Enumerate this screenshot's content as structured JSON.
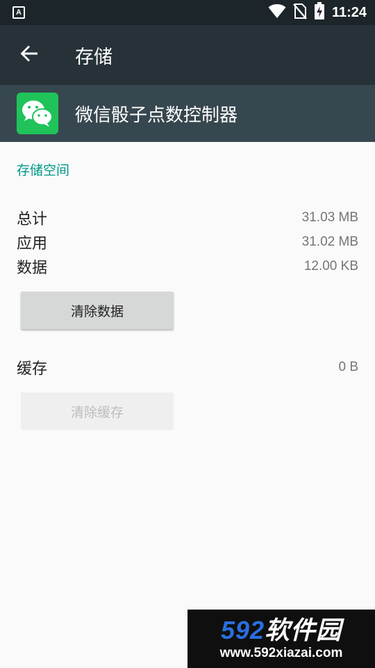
{
  "status_bar": {
    "notification_letter": "A",
    "time": "11:24",
    "icons": [
      "wifi-icon",
      "no-sim-icon",
      "battery-charging-icon"
    ]
  },
  "app_bar": {
    "title": "存储",
    "back_icon": "arrow-back-icon"
  },
  "app_header": {
    "app_name": "微信骰子点数控制器",
    "app_icon": "wechat-icon",
    "app_icon_color": "#1fc35a"
  },
  "storage": {
    "section_title": "存储空间",
    "total_label": "总计",
    "total_value": "31.03 MB",
    "app_label": "应用",
    "app_value": "31.02 MB",
    "data_label": "数据",
    "data_value": "12.00 KB",
    "clear_data_label": "清除数据",
    "cache_label": "缓存",
    "cache_value": "0 B",
    "clear_cache_label": "清除缓存"
  },
  "watermark": {
    "logo_number": "592",
    "logo_text": "软件园",
    "url": "www.592xiazai.com"
  },
  "colors": {
    "status_bar_bg": "#1c2529",
    "app_bar_bg": "#263238",
    "header_bg": "#37474f",
    "accent": "#009688"
  }
}
